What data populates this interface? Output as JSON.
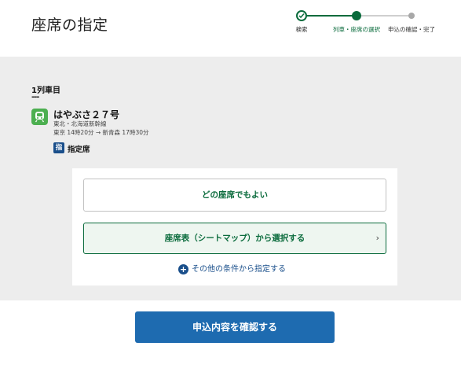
{
  "header": {
    "title": "座席の指定"
  },
  "stepper": {
    "steps": [
      {
        "label": "検索",
        "state": "done"
      },
      {
        "label": "列車・座席の選択",
        "state": "current"
      },
      {
        "label": "申込の確認・完了",
        "state": "upcoming"
      }
    ],
    "colors": {
      "done": "#0a6b3c",
      "upcoming": "#a8a8a8"
    }
  },
  "car": {
    "title": "1列車目",
    "subtitle": "---"
  },
  "train": {
    "icon": "train-icon",
    "name": "はやぶさ２７号",
    "line": "東北・北海道新幹線",
    "schedule": "東京 14時20分 → 新青森 17時30分",
    "seat_badge": "指",
    "seat_type": "指定席"
  },
  "seat_options": {
    "any_seat": "どの座席でもよい",
    "seat_map": "座席表（シートマップ）から選択する",
    "seat_map_chevron": "›",
    "other_conditions": "その他の条件から指定する",
    "other_icon": "plus-circle-icon"
  },
  "footer": {
    "confirm_label": "申込内容を確認する"
  },
  "colors": {
    "accent_green": "#0a6b3c",
    "primary_blue": "#1e6bb0",
    "link_blue": "#1a4f8b",
    "train_icon_green": "#4caf50"
  }
}
